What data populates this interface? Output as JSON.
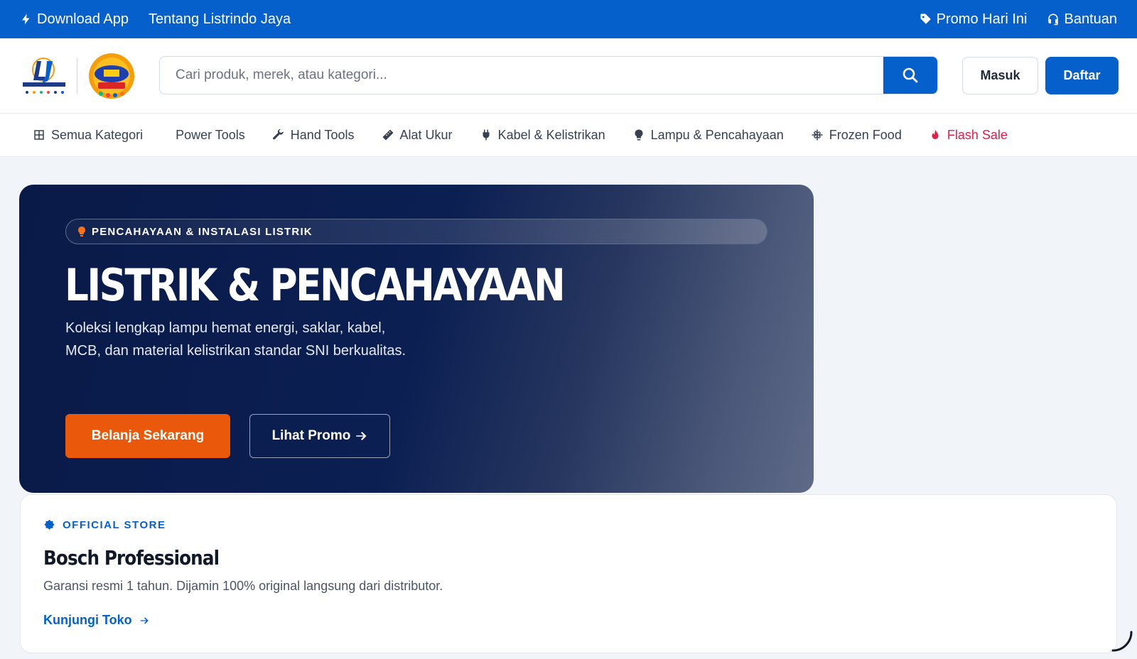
{
  "topbar": {
    "download_app": "Download App",
    "about": "Tentang Listrindo Jaya",
    "promo": "Promo Hari Ini",
    "help": "Bantuan"
  },
  "header": {
    "search_placeholder": "Cari produk, merek, atau kategori...",
    "login": "Masuk",
    "register": "Daftar"
  },
  "categories": [
    {
      "label": "Semua Kategori",
      "icon": "grid-icon"
    },
    {
      "label": "Power Tools",
      "icon": ""
    },
    {
      "label": "Hand Tools",
      "icon": "wrench-icon"
    },
    {
      "label": "Alat Ukur",
      "icon": "ruler-icon"
    },
    {
      "label": "Kabel & Kelistrikan",
      "icon": "plug-icon"
    },
    {
      "label": "Lampu & Pencahayaan",
      "icon": "lightbulb-icon"
    },
    {
      "label": "Frozen Food",
      "icon": "snowflake-icon"
    },
    {
      "label": "Flash Sale",
      "icon": "fire-icon"
    }
  ],
  "hero": {
    "tag": "PENCAHAYAAN & INSTALASI LISTRIK",
    "title": "LISTRIK & PENCAHAYAAN",
    "description": "Koleksi lengkap lampu hemat energi, saklar, kabel, MCB, dan material kelistrikan standar SNI berkualitas.",
    "primary_cta": "Belanja Sekarang",
    "secondary_cta": "Lihat Promo"
  },
  "store": {
    "label": "OFFICIAL STORE",
    "name": "Bosch Professional",
    "description": "Garansi resmi 1 tahun. Dijamin 100% original langsung dari distributor.",
    "link": "Kunjungi Toko"
  },
  "colors": {
    "primary": "#0660cc",
    "accent": "#ea580c",
    "flash": "#e11d48",
    "hero_dark": "#0a1a48"
  }
}
